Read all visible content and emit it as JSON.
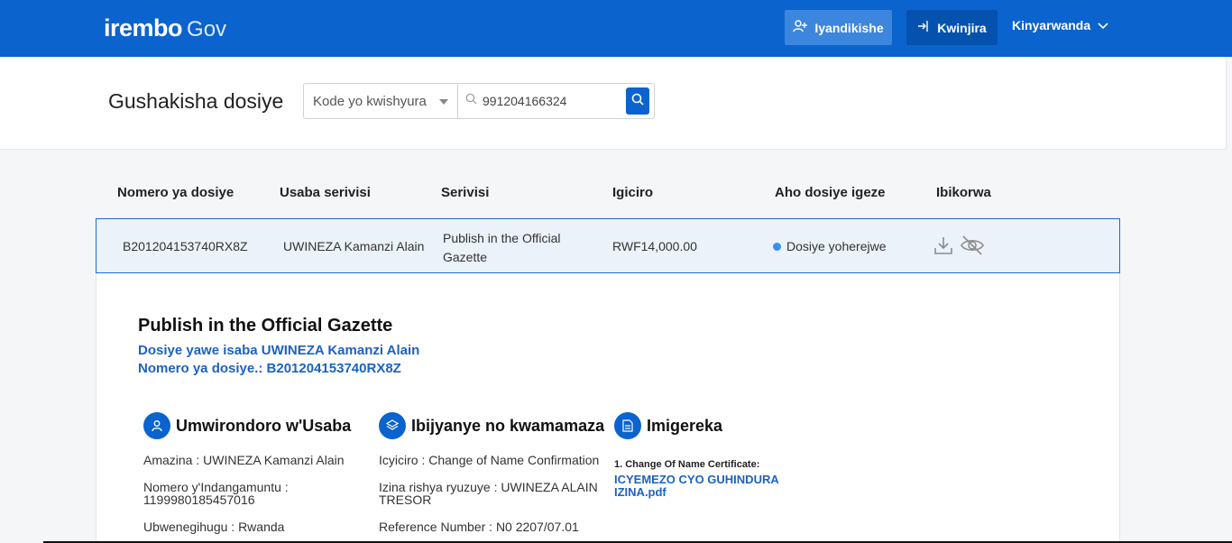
{
  "nav": {
    "logo_brand": "irembo",
    "logo_gov": "Gov",
    "register_label": "Iyandikishe",
    "login_label": "Kwinjira",
    "language_label": "Kinyarwanda"
  },
  "search": {
    "page_title": "Gushakisha dosiye",
    "select_value": "Kode yo kwishyura",
    "input_value": "991204166324"
  },
  "table": {
    "headers": [
      "Nomero ya dosiye",
      "Usaba serivisi",
      "Serivisi",
      "Igiciro",
      "Aho dosiye igeze",
      "Ibikorwa"
    ],
    "row": {
      "file_number": "B201204153740RX8Z",
      "applicant": "UWINEZA Kamanzi Alain",
      "service_line1": "Publish in the Official",
      "service_line2": "Gazette",
      "price": "RWF14,000.00",
      "status": "Dosiye yoherejwe"
    }
  },
  "detail": {
    "title": "Publish in the Official Gazette",
    "applicant_line": "Dosiye yawe isaba UWINEZA Kamanzi Alain",
    "file_number_line": "Nomero ya dosiye.: B201204153740RX8Z",
    "profile": {
      "heading": "Umwirondoro w'Usaba",
      "name": "Amazina : UWINEZA Kamanzi Alain",
      "id_label": "Nomero y'Indangamuntu :",
      "id_value": "1199980185457016",
      "nationality": "Ubwenegihugu : Rwanda"
    },
    "request": {
      "heading": "Ibijyanye no kwamamaza",
      "category": "Icyiciro : Change of Name Confirmation",
      "new_name_line1": "Izina rishya ryuzuye : UWINEZA ALAIN",
      "new_name_line2": "TRESOR",
      "reference": "Reference Number : N0 2207/07.01"
    },
    "attachments": {
      "heading": "Imigereka",
      "item_label": "1. Change Of Name Certificate:",
      "item_link_line1": "ICYEMEZO CYO GUHINDURA",
      "item_link_line2": "IZINA.pdf"
    }
  },
  "colors": {
    "primary": "#0b63ce",
    "link": "#1b62c2",
    "status_dot": "#3a8eec",
    "row_highlight": "#ebf2fa"
  }
}
